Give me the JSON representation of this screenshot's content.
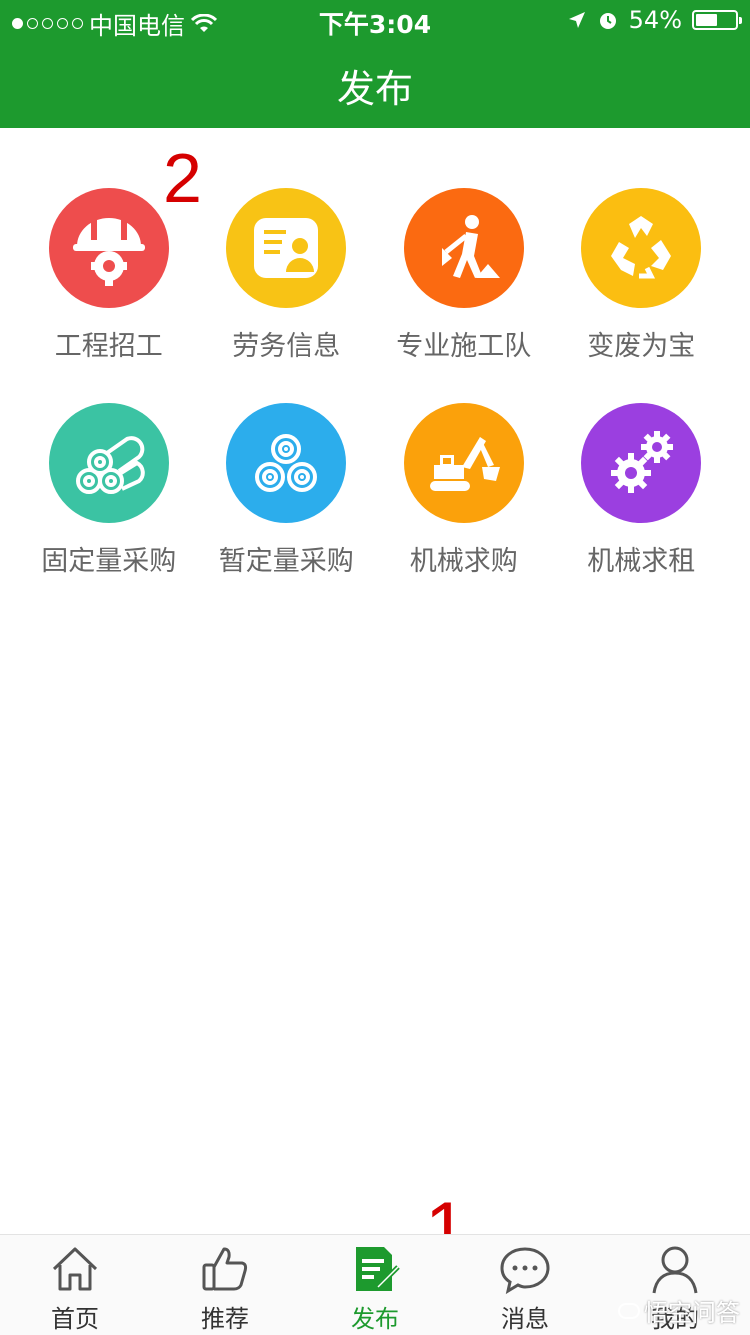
{
  "status_bar": {
    "carrier": "中国电信",
    "time": "下午3:04",
    "battery": "54%",
    "battery_level": 0.54,
    "signal_bars": 1
  },
  "navbar": {
    "title": "发布"
  },
  "grid": {
    "items": [
      {
        "label": "工程招工",
        "color": "#ee4d4d",
        "icon": "helmet-gear-icon"
      },
      {
        "label": "劳务信息",
        "color": "#f8c315",
        "icon": "id-card-icon"
      },
      {
        "label": "专业施工队",
        "color": "#fb6a11",
        "icon": "worker-shovel-icon"
      },
      {
        "label": "变废为宝",
        "color": "#fbbe11",
        "icon": "recycle-icon"
      },
      {
        "label": "固定量采购",
        "color": "#3bc3a3",
        "icon": "pipes-icon"
      },
      {
        "label": "暂定量采购",
        "color": "#2cadec",
        "icon": "rolls-icon"
      },
      {
        "label": "机械求购",
        "color": "#fba10b",
        "icon": "excavator-icon"
      },
      {
        "label": "机械求租",
        "color": "#9b3fe0",
        "icon": "gears-icon"
      }
    ]
  },
  "annotations": {
    "one": "1",
    "two": "2"
  },
  "tabbar": {
    "items": [
      {
        "label": "首页",
        "icon": "home-icon",
        "active": false
      },
      {
        "label": "推荐",
        "icon": "thumbs-up-icon",
        "active": false
      },
      {
        "label": "发布",
        "icon": "edit-doc-icon",
        "active": true
      },
      {
        "label": "消息",
        "icon": "chat-bubble-icon",
        "active": false
      },
      {
        "label": "我的",
        "icon": "user-icon",
        "active": false
      }
    ],
    "active_color": "#1d9a2e"
  },
  "watermark": {
    "text": "悟空问答"
  }
}
